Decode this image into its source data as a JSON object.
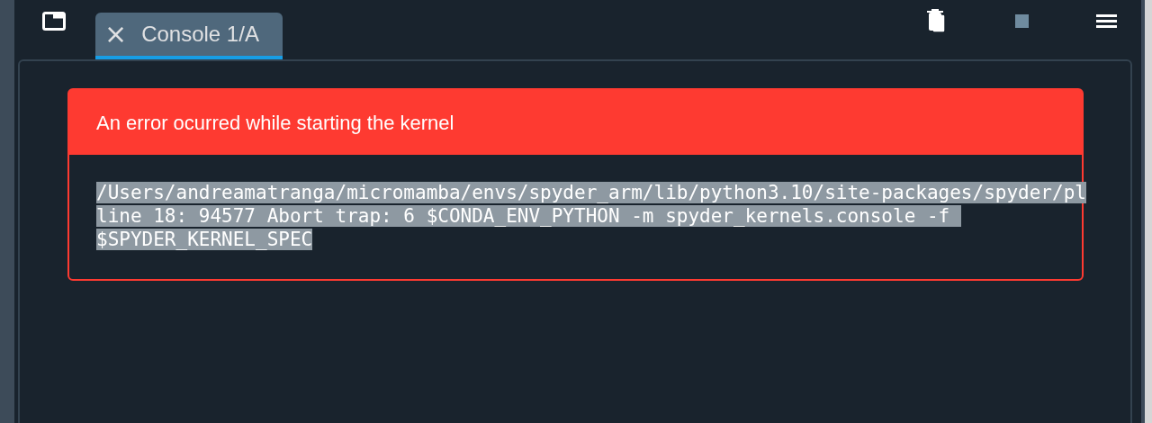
{
  "tab": {
    "close": "×",
    "label": "Console 1/A",
    "selected": true
  },
  "error": {
    "title": "An error ocurred while starting the kernel",
    "lines": [
      "/Users/andreamatranga/micromamba/envs/spyder_arm/lib/python3.10/site-packages/spyder/pl",
      "line 18: 94577 Abort trap: 6 $CONDA_ENV_PYTHON -m spyder_kernels.console -f ",
      "$SPYDER_KERNEL_SPEC"
    ]
  }
}
